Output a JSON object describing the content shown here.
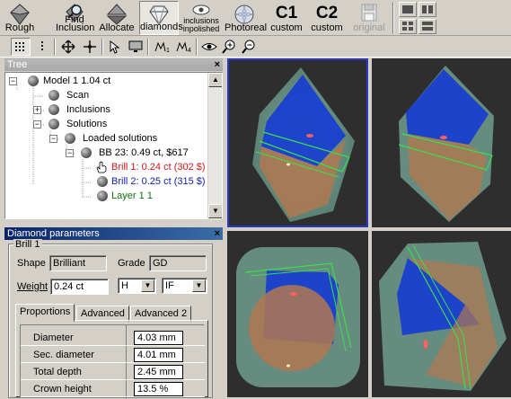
{
  "toolbar": {
    "rough": "Rough",
    "find_inclusion": "Find\nInclusion",
    "find_line1": "Find",
    "find_line2": "Inclusion",
    "allocate": "Allocate",
    "diamonds": "diamonds",
    "incl_line1": "inclusions",
    "incl_line2": "inpolished",
    "photoreal": "Photoreal",
    "c1_big": "C1",
    "c1_label": "custom",
    "c2_big": "C2",
    "c2_label": "custom",
    "original": "original"
  },
  "tree_panel": {
    "title": "Tree",
    "close": "×",
    "items": [
      {
        "label": "Model 1 1.04 ct",
        "color": "#000000"
      },
      {
        "label": "Scan",
        "color": "#000000"
      },
      {
        "label": "Inclusions",
        "color": "#000000"
      },
      {
        "label": "Solutions",
        "color": "#000000"
      },
      {
        "label": "Loaded solutions",
        "color": "#000000"
      },
      {
        "label": "BB 23: 0.49 ct,  $617",
        "color": "#000000"
      },
      {
        "label": "Brill 1: 0.24 ct (302 $)",
        "color": "#d01818"
      },
      {
        "label": "Brill 2: 0.25 ct (315 $)",
        "color": "#1020a8"
      },
      {
        "label": "Layer 1 1",
        "color": "#107010"
      }
    ]
  },
  "params_panel": {
    "title": "Diamond parameters",
    "close": "×",
    "group": "Brill 1",
    "shape_label": "Shape",
    "shape_value": "Brilliant",
    "grade_label": "Grade",
    "grade_value": "GD",
    "weight_label": "Weight",
    "weight_value": "0.24 ct",
    "color_value": "H",
    "clarity_value": "IF",
    "tabs": [
      "Proportions",
      "Advanced",
      "Advanced 2"
    ],
    "props": [
      {
        "name": "Diameter",
        "value": "4.03 mm"
      },
      {
        "name": "Sec. diameter",
        "value": "4.01 mm"
      },
      {
        "name": "Total depth",
        "value": "2.45 mm"
      },
      {
        "name": "Crown height",
        "value": "13.5 %"
      }
    ]
  },
  "colors": {
    "viewport_bg": "#2e2e2e",
    "selected_border": "#2a3ac8",
    "stone_shell": "#6f9c8c",
    "diamond_blue": "#1a3fd0",
    "diamond_orange": "#b07850",
    "outline_green": "#39e04a"
  },
  "icons": [
    "rough-icon",
    "find-inclusion-icon",
    "allocate-icon",
    "diamonds-icon",
    "inclusions-icon",
    "photoreal-icon",
    "original-icon",
    "layout-grid-icon",
    "move-icon",
    "pan-icon",
    "zoom-in-icon",
    "zoom-out-icon",
    "eye-icon",
    "hand-cursor-icon"
  ]
}
